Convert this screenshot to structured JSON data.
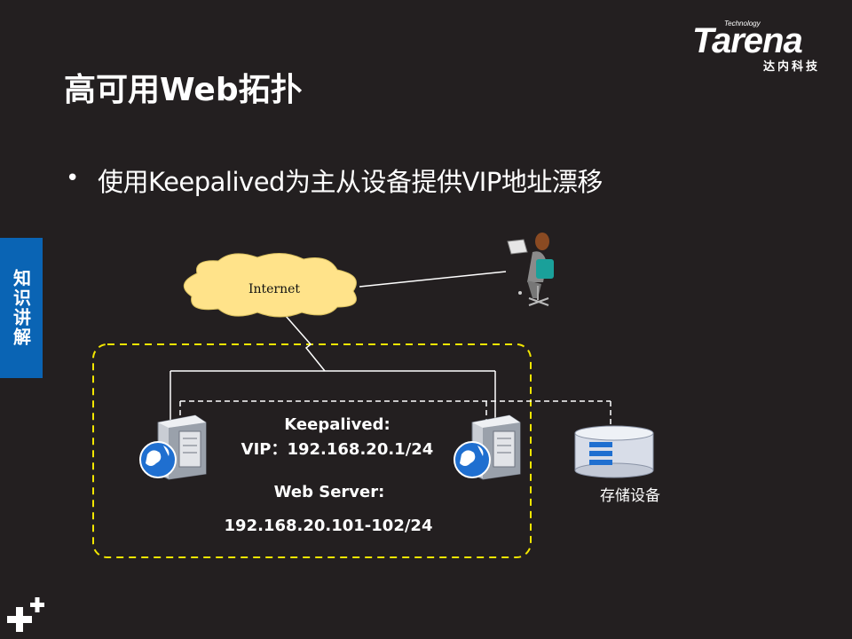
{
  "logo": {
    "tech": "Technology",
    "brand": "Tarena",
    "sub": "达内科技"
  },
  "title": "高可用Web拓扑",
  "bullet": "使用Keepalived为主从设备提供VIP地址漂移",
  "side_tab": "知识讲解",
  "diagram": {
    "cloud_label": "Internet",
    "keepalived_label": "Keepalived:",
    "vip_label": "VIP：192.168.20.1/24",
    "webserver_label": "Web Server:",
    "webserver_ip": "192.168.20.101-102/24",
    "storage_label": "存储设备",
    "colors": {
      "dashed_box": "#f2e600",
      "cloud": "#ffe38a",
      "accent_blue": "#0a64b4",
      "line": "#ffffff"
    }
  }
}
